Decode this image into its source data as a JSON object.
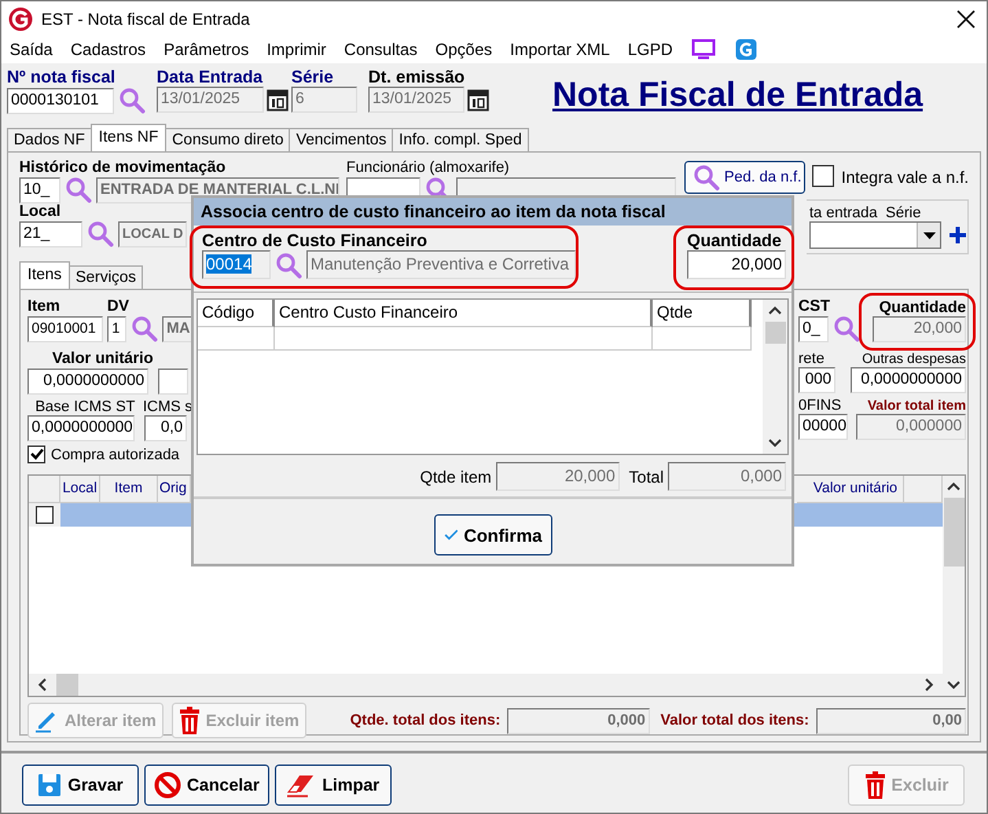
{
  "window": {
    "title": "EST - Nota fiscal de Entrada"
  },
  "menu": [
    {
      "label": "Saída"
    },
    {
      "label": "Cadastros"
    },
    {
      "label": "Parâmetros"
    },
    {
      "label": "Imprimir"
    },
    {
      "label": "Consultas"
    },
    {
      "label": "Opções"
    },
    {
      "label": "Importar XML"
    },
    {
      "label": "LGPD"
    }
  ],
  "header": {
    "fields": [
      {
        "label": "Nº nota fiscal",
        "value": "0000130101",
        "kind": "search"
      },
      {
        "label": "Data Entrada",
        "value": "13/01/2025",
        "kind": "date"
      },
      {
        "label": "Série",
        "value": "6",
        "kind": "plain"
      },
      {
        "label": "Dt. emissão",
        "value": "13/01/2025",
        "kind": "date"
      }
    ],
    "title": "Nota Fiscal de Entrada"
  },
  "tabs": [
    {
      "label": "Dados NF",
      "selected": false
    },
    {
      "label": "Itens NF",
      "selected": true
    },
    {
      "label": "Consumo direto",
      "selected": false
    },
    {
      "label": "Vencimentos",
      "selected": false
    },
    {
      "label": "Info. compl. Sped",
      "selected": false
    }
  ],
  "movement": {
    "historico_label": "Histórico de movimentação",
    "historico_code": "10_",
    "historico_name": "ENTRADA DE MANTERIAL C.L.NI",
    "funcionario_label": "Funcionário (almoxarife)",
    "local_label": "Local",
    "local_code": "21_",
    "local_name": "LOCAL D",
    "ped_button": "Ped. da n.f.",
    "integra": {
      "label": "Integra vale a n.f.",
      "checked": false
    },
    "entrada_label": "ta entrada",
    "serie_label": "Série"
  },
  "subtabs": [
    {
      "label": "Itens",
      "selected": true
    },
    {
      "label": "Serviços",
      "selected": false
    }
  ],
  "item": {
    "item_label": "Item",
    "item_code": "09010001",
    "dv_label": "DV",
    "dv": "1",
    "desc": "MA",
    "cst_label": "CST",
    "cst": "0_",
    "qty_label": "Quantidade",
    "qty": "20,000",
    "valor_label": "Valor unitário",
    "valor": "0,0000000000",
    "base_label": "Base ICMS ST",
    "base": "0,0000000000",
    "icms_label": "ICMS s",
    "icms": "0,0",
    "frete_label": "rete",
    "frete": "000",
    "outras_label": "Outras despesas",
    "outras": "0,0000000000",
    "cofins_label": "0FINS",
    "cofins": "00000",
    "total_label": "Valor total item",
    "total": "0,000000",
    "compra": {
      "label": "Compra autorizada",
      "checked": true
    }
  },
  "grid": {
    "columns_left": [
      "Local",
      "Item",
      "Orig"
    ],
    "columns_right": [
      "Valor unitário"
    ],
    "rows": [
      {
        "selected": true,
        "checked": false
      }
    ]
  },
  "item_buttons": [
    {
      "label": "Alterar item",
      "kind": "edit",
      "disabled": true
    },
    {
      "label": "Excluir item",
      "kind": "delete",
      "disabled": true
    }
  ],
  "totals": [
    {
      "label": "Qtde. total dos itens:",
      "value": "0,000"
    },
    {
      "label": "Valor total dos itens:",
      "value": "0,00"
    }
  ],
  "bottom_buttons": [
    {
      "label": "Gravar",
      "kind": "save",
      "disabled": false
    },
    {
      "label": "Cancelar",
      "kind": "cancel",
      "disabled": false
    },
    {
      "label": "Limpar",
      "kind": "clear",
      "disabled": false
    }
  ],
  "delete_button": {
    "label": "Excluir",
    "kind": "delete",
    "disabled": true
  },
  "dialog": {
    "title": "Associa centro de custo financeiro ao item da nota fiscal",
    "centro_label": "Centro de Custo Financeiro",
    "code": "00014",
    "description": "Manutenção Preventiva e Corretiva",
    "qty_label": "Quantidade",
    "qty": "20,000",
    "columns": [
      "Código",
      "Centro Custo Financeiro",
      "Qtde"
    ],
    "qtde_item_label": "Qtde item",
    "qtde_item": "20,000",
    "total_label": "Total",
    "total": "0,000",
    "confirm": "Confirma"
  }
}
